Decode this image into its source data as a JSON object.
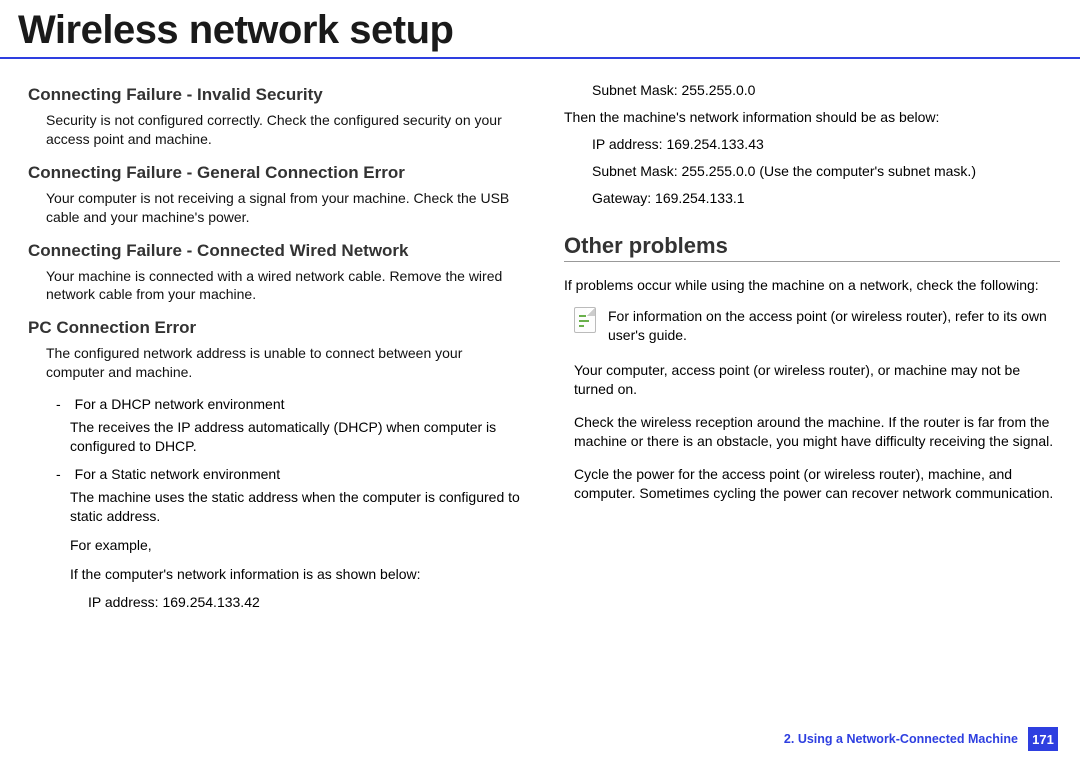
{
  "title": "Wireless network setup",
  "left": {
    "s1": {
      "h": "Connecting Failure - Invalid Security",
      "p": "Security is not configured correctly. Check the configured security on your access point and machine."
    },
    "s2": {
      "h": "Connecting Failure - General Connection Error",
      "p": "Your computer is not receiving a signal from your machine. Check the USB cable and your machine's power."
    },
    "s3": {
      "h": "Connecting Failure - Connected Wired Network",
      "p": "Your machine is connected with a wired network cable. Remove the wired network cable from your machine."
    },
    "s4": {
      "h": "PC Connection Error",
      "p": "The configured network address is unable to connect between your computer and machine.",
      "d1": "For a DHCP network environment",
      "d1b": "The receives the IP address automatically (DHCP) when computer is configured to DHCP.",
      "d2": "For a Static network environment",
      "d2b": "The machine uses the static address when the computer is configured to static address.",
      "ex": "For example,",
      "ex2": "If the computer's network information is as shown below:",
      "ip": "IP address: 169.254.133.42"
    }
  },
  "right": {
    "subnet_top": "Subnet Mask: 255.255.0.0",
    "then": "Then the machine's network information should be as below:",
    "ip": "IP address: 169.254.133.43",
    "subnet": "Subnet Mask: 255.255.0.0 (Use the computer's subnet mask.)",
    "gateway": "Gateway: 169.254.133.1",
    "sec": "Other problems",
    "intro": "If problems occur while using the machine on a network, check the following:",
    "note": "For information on the access point (or wireless router), refer to its own user's guide.",
    "b1": "Your computer, access point (or wireless router), or machine may not be turned on.",
    "b2": "Check the wireless reception around the machine. If the router is far from the machine or there is an obstacle, you might have difficulty receiving the signal.",
    "b3": "Cycle the power for the access point (or wireless router), machine, and computer. Sometimes cycling the power can recover network communication."
  },
  "footer": {
    "chapter": "2.  Using a Network-Connected Machine",
    "page": "171"
  }
}
